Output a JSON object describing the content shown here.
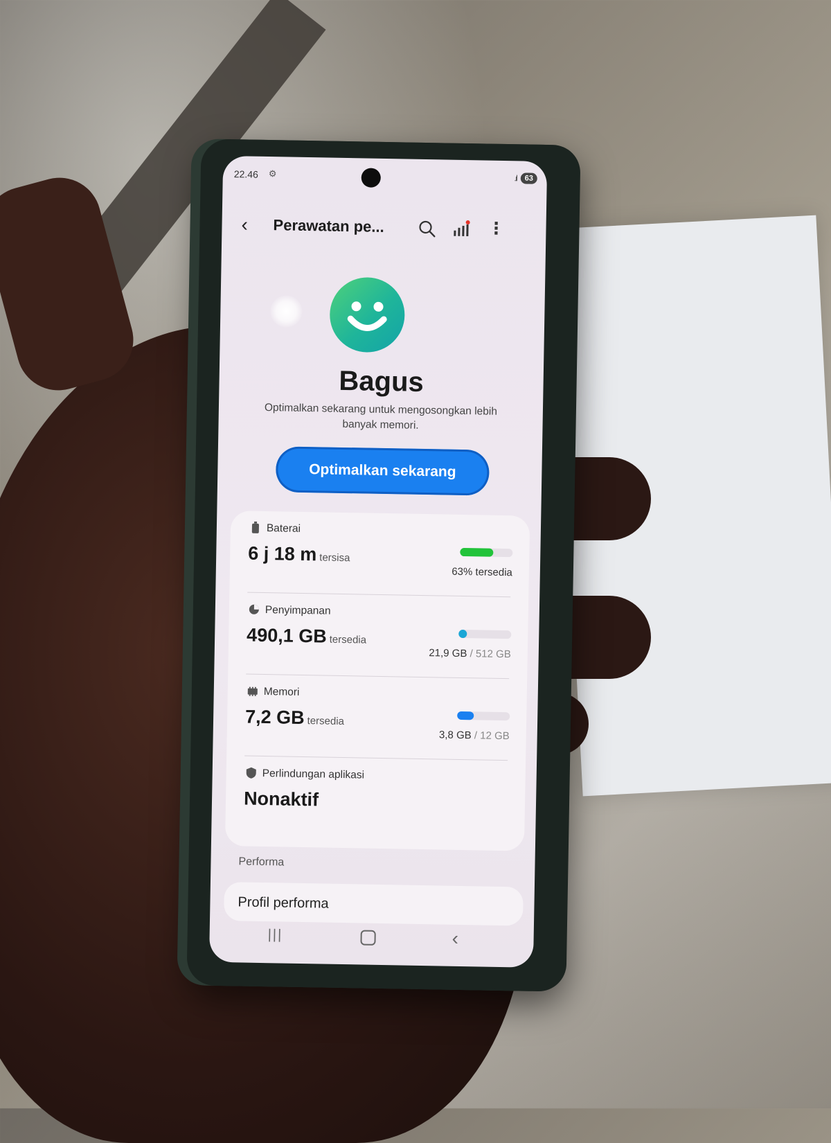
{
  "status_bar": {
    "time": "22.46",
    "battery_level": "63"
  },
  "app_bar": {
    "title": "Perawatan pe..."
  },
  "summary": {
    "status": "Bagus",
    "description": "Optimalkan sekarang untuk mengosongkan lebih banyak memori.",
    "optimize_label": "Optimalkan sekarang"
  },
  "battery": {
    "label": "Baterai",
    "value": "6 j 18 m",
    "unit": "tersisa",
    "right_text": "63% tersedia",
    "level": 0.63,
    "color": "#22c33a"
  },
  "storage": {
    "label": "Penyimpanan",
    "value": "490,1 GB",
    "unit": "tersedia",
    "used": "21,9 GB",
    "total": "/ 512 GB",
    "level": 0.04,
    "color": "#1aa6d6"
  },
  "memory": {
    "label": "Memori",
    "value": "7,2 GB",
    "unit": "tersedia",
    "used": "3,8 GB",
    "total": "/ 12 GB",
    "level": 0.32,
    "color": "#1a80f0"
  },
  "app_protection": {
    "label": "Perlindungan aplikasi",
    "value": "Nonaktif"
  },
  "performance": {
    "section": "Performa",
    "item": "Profil performa"
  },
  "colors": {
    "accent": "#1a80f0",
    "face_green": "#4fd17a",
    "face_teal": "#13a3a8"
  }
}
